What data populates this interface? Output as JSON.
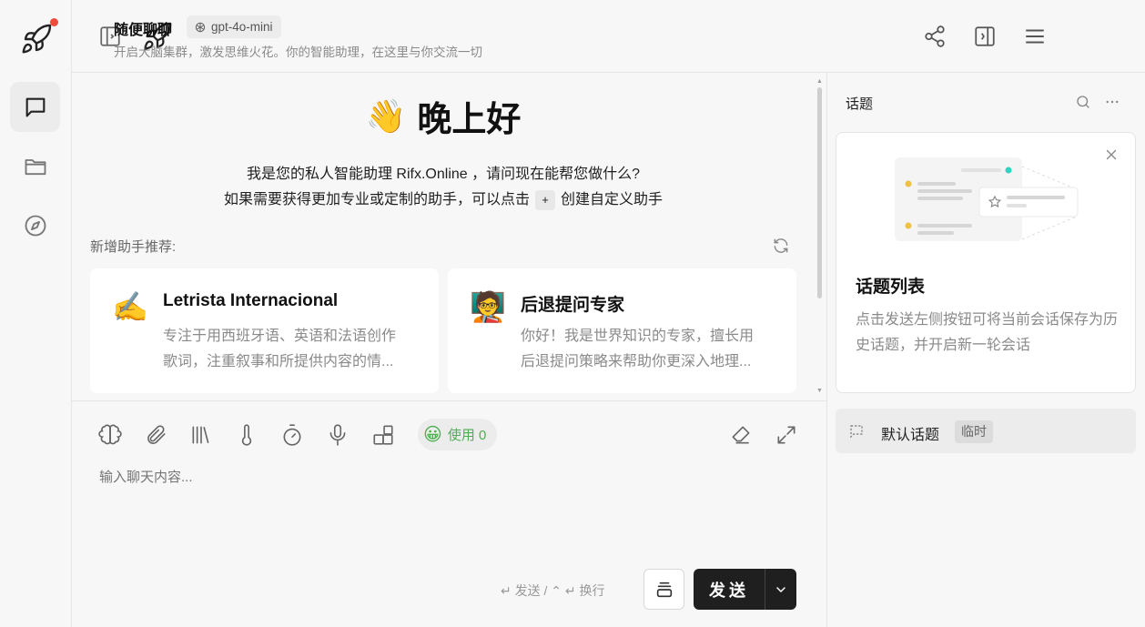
{
  "header": {
    "title": "随便聊聊",
    "model": "gpt-4o-mini",
    "subtitle": "开启大脑集群，激发思维火花。你的智能助理，在这里与你交流一切"
  },
  "welcome": {
    "emoji": "👋",
    "greeting": "晚上好",
    "line1": "我是您的私人智能助理 Rifx.Online ，请问现在能帮您做什么?",
    "line2_before": "如果需要获得更加专业或定制的助手，可以点击",
    "plus_key": "+",
    "line2_after": "创建自定义助手"
  },
  "recommend": {
    "label": "新增助手推荐:",
    "cards": [
      {
        "emoji": "✍️",
        "title": "Letrista Internacional",
        "desc_line1": "专注于用西班牙语、英语和法语创作",
        "desc_line2": "歌词，注重叙事和所提供内容的情..."
      },
      {
        "emoji": "🧑‍🏫",
        "title": "后退提问专家",
        "desc_line1": "你好！我是世界知识的专家，擅长用",
        "desc_line2": "后退提问策略来帮助你更深入地理..."
      }
    ]
  },
  "input": {
    "usage_label": "使用 0",
    "usage_emoji": "😀",
    "placeholder": "输入聊天内容...",
    "shortcut_hint": "↵ 发送 / ⌃ ↵ 换行",
    "send_label": "发送"
  },
  "topics": {
    "title": "话题",
    "card_heading": "话题列表",
    "card_desc": "点击发送左侧按钮可将当前会话保存为历史话题，并开启新一轮会话",
    "default_label": "默认话题",
    "default_badge": "临时"
  },
  "icons": {
    "rail": [
      "rocket-icon",
      "chat-icon",
      "folder-icon",
      "compass-icon"
    ],
    "toolbar": [
      "brain-icon",
      "paperclip-icon",
      "library-icon",
      "thermometer-icon",
      "timer-icon",
      "microphone-icon",
      "plugin-icon"
    ]
  },
  "colors": {
    "notification_dot": "#ee4b3a",
    "usage_green": "#4caf50",
    "send_button": "#1f1f1f"
  }
}
